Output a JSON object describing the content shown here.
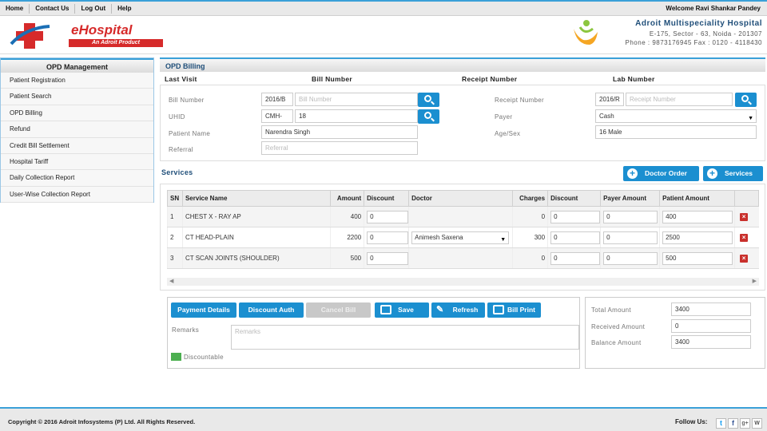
{
  "topnav": {
    "home": "Home",
    "contact": "Contact Us",
    "logout": "Log Out",
    "help": "Help",
    "welcome": "Welcome Ravi Shankar Pandey"
  },
  "brand": {
    "name": "eHospital",
    "tagline": "An Adroit Product"
  },
  "hospital": {
    "name": "Adroit Multispeciality Hospital",
    "address": "E-175, Sector - 63, Noida - 201307",
    "phone": "Phone : 9873176945 Fax : 0120 - 4118430"
  },
  "sidebar": {
    "title": "OPD Management",
    "items": [
      {
        "label": "Patient Registration"
      },
      {
        "label": "Patient Search"
      },
      {
        "label": "OPD Billing"
      },
      {
        "label": "Refund"
      },
      {
        "label": "Credit Bill Settlement"
      },
      {
        "label": "Hospital Tariff"
      },
      {
        "label": "Daily Collection Report"
      },
      {
        "label": "User-Wise Collection Report"
      }
    ]
  },
  "billing": {
    "title": "OPD Billing",
    "heads": {
      "last_visit": "Last Visit",
      "bill_number": "Bill Number",
      "receipt_number": "Receipt Number",
      "lab_number": "Lab Number"
    },
    "bill_number_label": "Bill Number",
    "bill_prefix": "2016/B",
    "bill_placeholder": "Bill Number",
    "uhid_label": "UHID",
    "uhid_prefix": "CMH-",
    "uhid_value": "18",
    "patient_name_label": "Patient Name",
    "patient_name": "Narendra Singh",
    "referral_label": "Referral",
    "referral_placeholder": "Referral",
    "receipt_label": "Receipt Number",
    "receipt_prefix": "2016/R",
    "receipt_placeholder": "Receipt Number",
    "payer_label": "Payer",
    "payer_value": "Cash",
    "agesex_label": "Age/Sex",
    "agesex_value": "16 Male"
  },
  "services": {
    "title": "Services",
    "doctor_order_button": "Doctor Order",
    "services_button": "Services",
    "columns": [
      "SN",
      "Service Name",
      "Amount",
      "Discount",
      "Doctor",
      "Charges",
      "Discount",
      "Payer Amount",
      "Patient Amount",
      ""
    ],
    "rows": [
      {
        "sn": "1",
        "name": "CHEST X - RAY AP",
        "amount": "400",
        "discount": "0",
        "doctor": "",
        "charges": "0",
        "discount2": "0",
        "payer": "0",
        "patient": "400"
      },
      {
        "sn": "2",
        "name": "CT HEAD-PLAIN",
        "amount": "2200",
        "discount": "0",
        "doctor": "Animesh Saxena",
        "charges": "300",
        "discount2": "0",
        "payer": "0",
        "patient": "2500"
      },
      {
        "sn": "3",
        "name": "CT SCAN JOINTS (SHOULDER)",
        "amount": "500",
        "discount": "0",
        "doctor": "",
        "charges": "0",
        "discount2": "0",
        "payer": "0",
        "patient": "500"
      }
    ]
  },
  "actions": {
    "payment_details": "Payment Details",
    "discount_auth": "Discount Auth",
    "cancel_bill": "Cancel Bill",
    "save": "Save",
    "refresh": "Refresh",
    "bill_print": "Bill Print",
    "remarks_label": "Remarks",
    "remarks_placeholder": "Remarks",
    "discountable": "Discountable"
  },
  "totals": {
    "total_label": "Total Amount",
    "total_value": "3400",
    "received_label": "Received Amount",
    "received_value": "0",
    "balance_label": "Balance Amount",
    "balance_value": "3400"
  },
  "footer": {
    "copyright": "Copyright © 2016 Adroit Infosystems (P) Ltd. All Rights Reserved.",
    "follow": "Follow Us:"
  },
  "colors": {
    "accent": "#1b8fd0",
    "brand_red": "#d62a2a",
    "danger": "#c9302c",
    "header_blue": "#1f4e79"
  }
}
